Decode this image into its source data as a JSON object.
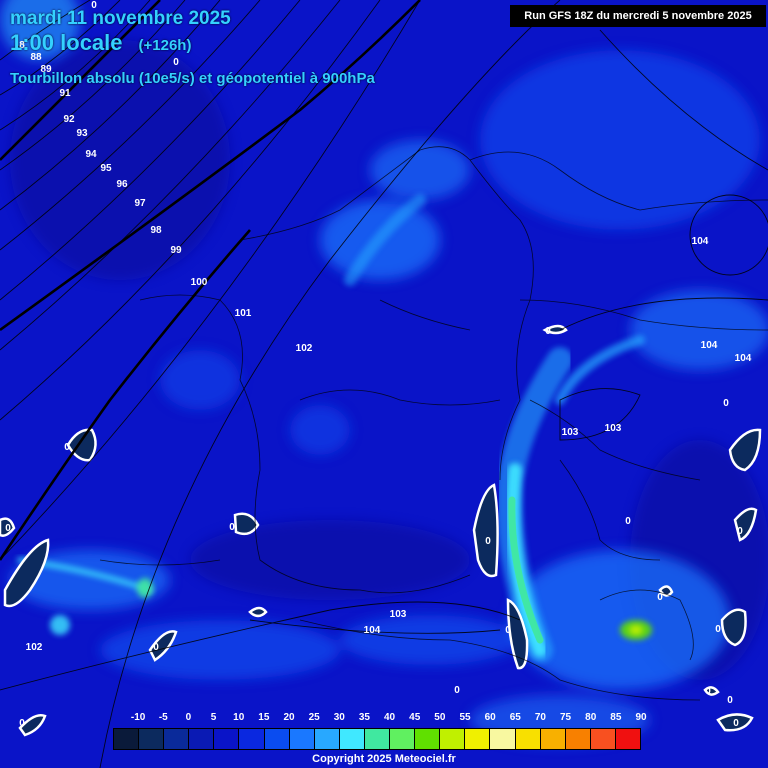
{
  "header": {
    "date_line": "mardi 11 novembre 2025",
    "time_line": "1:00 locale",
    "lead_time": "(+126h)",
    "field_name": "Tourbillon absolu (10e5/s) et géopotentiel à 900hPa",
    "run_info": "Run GFS 18Z du mercredi 5 novembre 2025"
  },
  "contour_labels": [
    "8",
    "88",
    "89",
    "91",
    "92",
    "93",
    "94",
    "95",
    "96",
    "97",
    "98",
    "99",
    "100",
    "101",
    "102",
    "102",
    "103",
    "103",
    "103",
    "104",
    "104",
    "104",
    "104",
    "0",
    "0",
    "0",
    "0",
    "0",
    "0",
    "0",
    "0",
    "0",
    "0",
    "0",
    "0",
    "0",
    "0",
    "0",
    "0",
    "0",
    "0",
    "0"
  ],
  "legend": {
    "ticks": [
      "-10",
      "-5",
      "0",
      "5",
      "10",
      "15",
      "20",
      "25",
      "30",
      "35",
      "40",
      "45",
      "50",
      "55",
      "60",
      "65",
      "70",
      "75",
      "80",
      "85",
      "90"
    ],
    "colors": [
      "#0a1a3a",
      "#0c2a5e",
      "#0a2a9a",
      "#0a1ab4",
      "#0a14c8",
      "#0a28e0",
      "#0a4cf0",
      "#1a78ff",
      "#28a8ff",
      "#40e8ff",
      "#40e8a0",
      "#60f060",
      "#60e000",
      "#c0f000",
      "#f0f000",
      "#f8f8a0",
      "#f8e000",
      "#f8b000",
      "#f88000",
      "#f85020",
      "#f01010"
    ]
  },
  "copyright": "Copyright 2025 Meteociel.fr",
  "colors": {
    "background": "#0a14c8",
    "title": "#34d1ff"
  }
}
